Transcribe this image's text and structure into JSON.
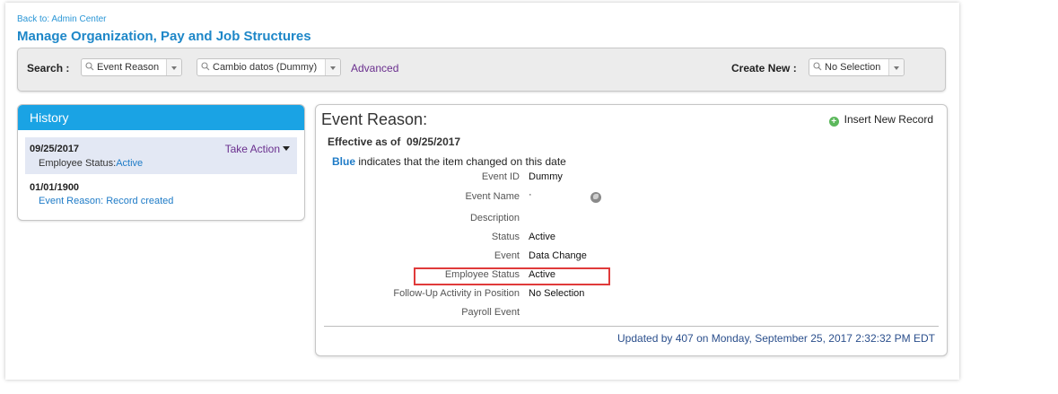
{
  "header": {
    "back_link": "Back to: Admin Center",
    "title": "Manage Organization, Pay and Job Structures"
  },
  "search": {
    "label": "Search :",
    "type_value": "Event Reason",
    "item_value": "Cambio datos (Dummy)",
    "advanced_label": "Advanced",
    "create_new_label": "Create New :",
    "create_new_value": "No Selection"
  },
  "history": {
    "title": "History",
    "entries": [
      {
        "date": "09/25/2017",
        "label": "Employee Status:",
        "value": "Active",
        "action": "Take Action"
      },
      {
        "date": "01/01/1900",
        "label": "Event Reason: Record created"
      }
    ]
  },
  "event": {
    "title": "Event Reason:",
    "insert_label": "Insert New Record",
    "effective_label": "Effective as of",
    "effective_date": "09/25/2017",
    "legend_blue": "Blue",
    "legend_text": "indicates that the item changed on this date",
    "fields": [
      {
        "label": "Event ID",
        "value": "Dummy"
      },
      {
        "label": "Event Name",
        "value": "·"
      },
      {
        "label": "Description",
        "value": ""
      },
      {
        "label": "Status",
        "value": "Active"
      },
      {
        "label": "Event",
        "value": "Data Change"
      },
      {
        "label": "Employee Status",
        "value": "Active"
      },
      {
        "label": "Follow-Up Activity in Position",
        "value": "No Selection"
      },
      {
        "label": "Payroll Event",
        "value": ""
      }
    ],
    "updated_text": "Updated by 407 on Monday, September 25, 2017 2:32:32 PM EDT"
  },
  "colors": {
    "accent": "#1aa3e4",
    "title_blue": "#1e87c8",
    "link_purple": "#6a2f8e",
    "highlight_red": "#e03a3a"
  }
}
